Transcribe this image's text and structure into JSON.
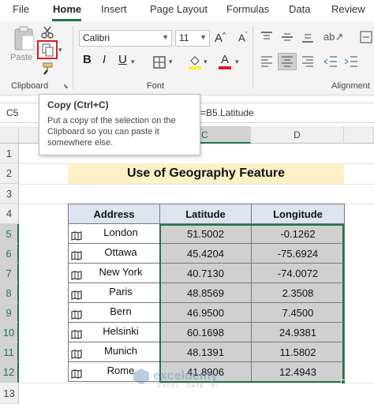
{
  "menu": {
    "items": [
      "File",
      "Home",
      "Insert",
      "Page Layout",
      "Formulas",
      "Data",
      "Review"
    ]
  },
  "ribbon": {
    "paste_label": "Paste",
    "font_name": "Calibri",
    "font_size": "11",
    "group_clipboard": "Clipboard",
    "group_font": "Font",
    "group_alignment": "Alignment"
  },
  "formula_bar": {
    "name_box": "C5",
    "formula": "=B5.Latitude"
  },
  "tooltip": {
    "title": "Copy (Ctrl+C)",
    "body": "Put a copy of the selection on the Clipboard so you can paste it somewhere else."
  },
  "columns": [
    "C",
    "D"
  ],
  "rows": [
    "1",
    "2",
    "3",
    "4",
    "5",
    "6",
    "7",
    "8",
    "9",
    "10",
    "11",
    "12",
    "13"
  ],
  "sheet": {
    "title": "Use of Geography Feature",
    "headers": [
      "Address",
      "Latitude",
      "Longitude"
    ],
    "data": [
      {
        "address": "London",
        "lat": "51.5002",
        "lon": "-0.1262"
      },
      {
        "address": "Ottawa",
        "lat": "45.4204",
        "lon": "-75.6924"
      },
      {
        "address": "New York",
        "lat": "40.7130",
        "lon": "-74.0072"
      },
      {
        "address": "Paris",
        "lat": "48.8569",
        "lon": "2.3508"
      },
      {
        "address": "Bern",
        "lat": "46.9500",
        "lon": "7.4500"
      },
      {
        "address": "Helsinki",
        "lat": "60.1698",
        "lon": "24.9381"
      },
      {
        "address": "Munich",
        "lat": "48.1391",
        "lon": "11.5802"
      },
      {
        "address": "Rome",
        "lat": "41.8906",
        "lon": "12.4943"
      }
    ]
  },
  "watermark": {
    "name": "exceldemy",
    "tagline": "EXCEL · DATA · BI"
  },
  "colors": {
    "accent": "#217346",
    "highlight": "#e01b1b",
    "title_fill": "#fdf0c7",
    "header_fill": "#dde3ef"
  }
}
